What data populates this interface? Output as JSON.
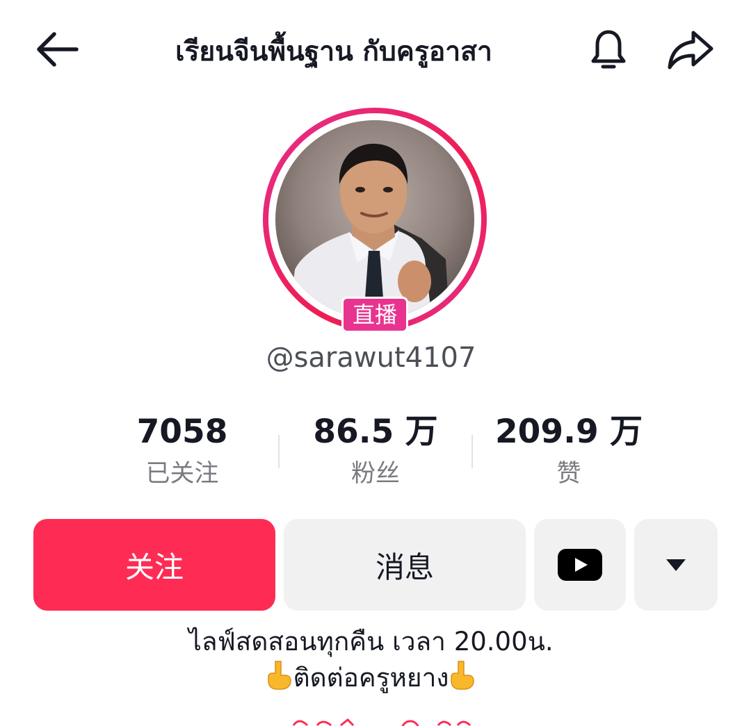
{
  "header": {
    "title": "เรียนจีนพื้นฐาน กับครูอาสา",
    "back_icon": "arrow-left-icon",
    "bell_icon": "bell-icon",
    "share_icon": "share-arrow-icon"
  },
  "profile": {
    "live_badge": "直播",
    "handle": "@sarawut4107",
    "ring_color": "#e52f8b"
  },
  "stats": [
    {
      "value": "7058",
      "label": "已关注"
    },
    {
      "value": "86.5 万",
      "label": "粉丝"
    },
    {
      "value": "209.9 万",
      "label": "赞"
    }
  ],
  "actions": {
    "follow_label": "关注",
    "message_label": "消息",
    "youtube_icon": "youtube-icon",
    "more_icon": "caret-down-icon",
    "follow_color": "#fe2c55"
  },
  "bio": {
    "line1": "ไลฟ์สดสอนทุกคืน เวลา 20.00น.",
    "line2": "ติดต่อครูหยาง",
    "line2_emoji": "pointing-down-hand-icon"
  }
}
